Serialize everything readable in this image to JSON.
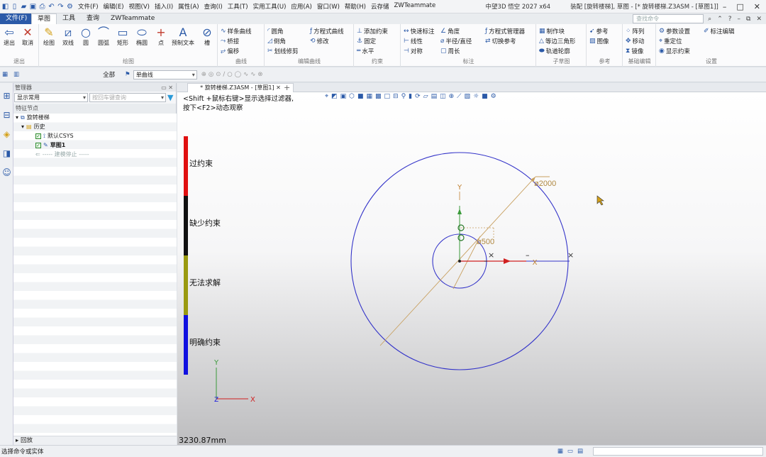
{
  "quick_access": {
    "menu_items": [
      "文件(F)",
      "编辑(E)",
      "视图(V)",
      "插入(I)",
      "属性(A)",
      "查询(I)",
      "工具(T)",
      "实用工具(U)",
      "应用(A)",
      "窗口(W)",
      "帮助(H)",
      "云存储",
      "ZWTeammate"
    ]
  },
  "title": {
    "app": "中望3D 悟空 2027 x64",
    "doc": "装配 [旋转楼梯], 草图 - [* 旋转楼梯.Z3ASM - [草图1]]"
  },
  "tabs": {
    "file": "文件(F)",
    "items": [
      "草图",
      "工具",
      "查询",
      "ZWTeammate"
    ]
  },
  "search": {
    "placeholder": "查找命令"
  },
  "ribbon": {
    "exit": {
      "exit": "退出",
      "cancel": "取消",
      "label": "退出"
    },
    "draw": {
      "items": [
        "绘图",
        "双线",
        "圆",
        "圆弧",
        "矩形",
        "椭圆",
        "点",
        "预制文本",
        "槽"
      ],
      "label": "绘图"
    },
    "curve": {
      "items": [
        "样条曲线",
        "桥接",
        "偏移"
      ],
      "label": "曲线"
    },
    "edit_curve": {
      "items": [
        "圆角",
        "倒角",
        "划线修剪",
        "方程式曲线",
        "修改"
      ],
      "label": "编辑曲线"
    },
    "constraint": {
      "items": [
        "添加约束",
        "固定",
        "水平"
      ],
      "label": "约束"
    },
    "dimension": {
      "items": [
        "快速标注",
        "线性",
        "对称",
        "角度",
        "半径/直径",
        "周长",
        "方程式管理器",
        "切换参考"
      ],
      "label": "标注"
    },
    "sub_sketch": {
      "items": [
        "制作块",
        "等边三角形",
        "轨道轮廓"
      ],
      "label": "子草图"
    },
    "reference": {
      "items": [
        "参考",
        "图像"
      ],
      "label": "参考"
    },
    "basic_edit": {
      "items": [
        "阵列",
        "移动",
        "镜像"
      ],
      "label": "基础编辑"
    },
    "settings": {
      "items": [
        "参数设置",
        "重定位",
        "显示约束",
        "标注编辑"
      ],
      "label": "设置"
    }
  },
  "subbar": {
    "filter_label": "全部",
    "curve_combo": "单曲线"
  },
  "panel": {
    "title": "管理器",
    "filter_combo": "显示常用",
    "filter_input_placeholder": "按回车键查询",
    "column_header": "特征节点",
    "tree": [
      {
        "label": "旋转楼梯"
      },
      {
        "label": "历史"
      },
      {
        "label": "默认CSYS"
      },
      {
        "label": "草图1"
      },
      {
        "label": "----- 建模停止 -----"
      }
    ],
    "footer": "回放"
  },
  "doc_tab": {
    "label": "* 旋转楼梯.Z3ASM - [草图1]"
  },
  "viewport": {
    "hint_line1": "<Shift +鼠标右键>显示选择过滤器,",
    "hint_line2": "按下<F2>动态观察",
    "legend": [
      {
        "label": "过约束",
        "color": "#e01010"
      },
      {
        "label": "缺少约束",
        "color": "#111111"
      },
      {
        "label": "无法求解",
        "color": "#9a9a10"
      },
      {
        "label": "明确约束",
        "color": "#1010e0"
      }
    ],
    "dim_outer": "ø2000",
    "dim_inner": "ø500",
    "axis_x": "X",
    "axis_y": "Y",
    "measure": "3230.87mm"
  },
  "status": {
    "text": "选择命令或实体"
  }
}
